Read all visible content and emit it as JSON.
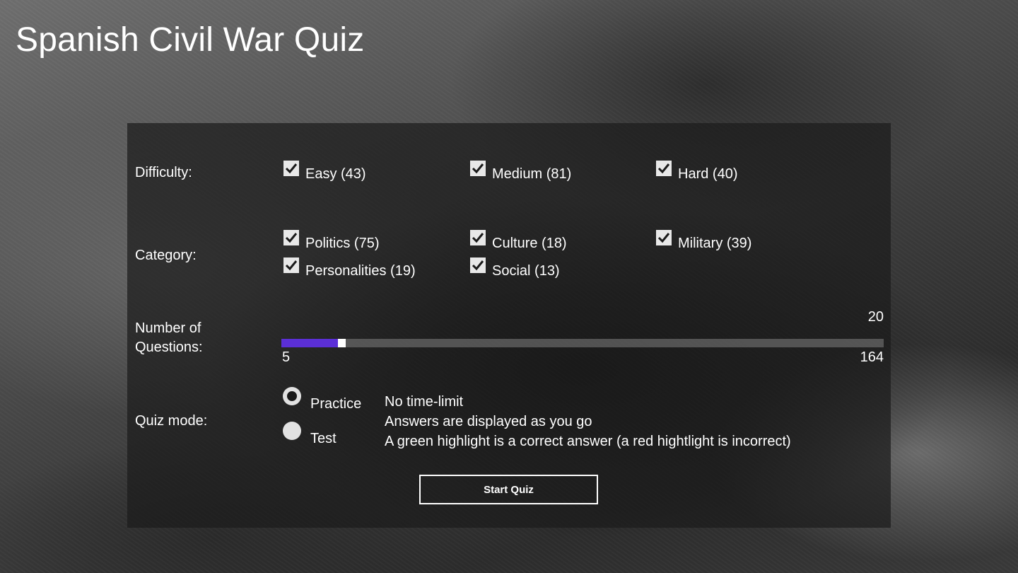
{
  "app": {
    "title": "Spanish Civil War Quiz"
  },
  "difficulty": {
    "label": "Difficulty:",
    "options": [
      {
        "label": "Easy (43)",
        "checked": true
      },
      {
        "label": "Medium (81)",
        "checked": true
      },
      {
        "label": "Hard (40)",
        "checked": true
      }
    ]
  },
  "category": {
    "label": "Category:",
    "options": [
      {
        "label": "Politics (75)",
        "checked": true
      },
      {
        "label": "Culture (18)",
        "checked": true
      },
      {
        "label": "Military (39)",
        "checked": true
      },
      {
        "label": "Personalities (19)",
        "checked": true
      },
      {
        "label": "Social (13)",
        "checked": true
      }
    ]
  },
  "questions": {
    "label_line1": "Number of",
    "label_line2": "Questions:",
    "value": "20",
    "min": "5",
    "max": "164"
  },
  "mode": {
    "label": "Quiz mode:",
    "options": [
      {
        "label": "Practice",
        "selected": true
      },
      {
        "label": "Test",
        "selected": false
      }
    ],
    "description": [
      "No time-limit",
      "Answers are displayed as you go",
      "A green highlight is a correct answer (a red hightlight is incorrect)"
    ]
  },
  "start_button": {
    "label": "Start Quiz"
  },
  "colors": {
    "slider_accent": "#5b2fd6",
    "panel_bg": "rgba(28,28,28,0.72)",
    "text": "#ffffff"
  },
  "icons": {
    "checkbox": "checkmark-icon"
  }
}
